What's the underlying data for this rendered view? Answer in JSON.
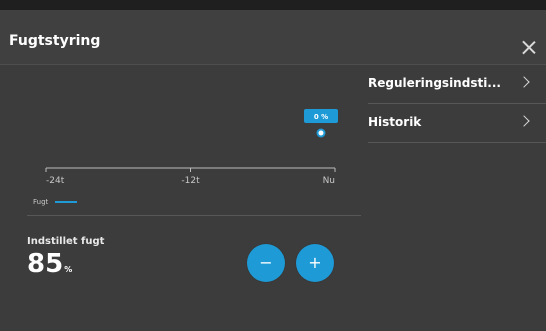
{
  "header": {
    "title": "Fugtstyring"
  },
  "menu": {
    "items": [
      {
        "label": "Reguleringsindsti..."
      },
      {
        "label": "Historik"
      }
    ]
  },
  "chart_data": {
    "type": "line",
    "x_labels": [
      "-24t",
      "-12t",
      "Nu"
    ],
    "series": [
      {
        "name": "Fugt",
        "color": "#1e9ad6",
        "points": [
          {
            "x": "Nu",
            "y": 0,
            "label": "0 %"
          }
        ]
      }
    ]
  },
  "setpoint": {
    "label": "Indstillet fugt",
    "value": "85",
    "unit": "%"
  },
  "controls": {
    "minus": "−",
    "plus": "+"
  },
  "colors": {
    "accent": "#1e9ad6",
    "background": "#3c3c3c"
  }
}
